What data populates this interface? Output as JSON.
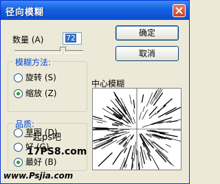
{
  "window": {
    "title": "径向模糊"
  },
  "amount": {
    "label": "数量 (A)",
    "value": "72"
  },
  "buttons": {
    "ok": "确定",
    "cancel": "取消"
  },
  "method": {
    "title": "模糊方法:",
    "options": [
      {
        "label": "旋转 (S)",
        "selected": false
      },
      {
        "label": "缩放 (Z)",
        "selected": true
      }
    ]
  },
  "quality": {
    "title": "品质:",
    "options": [
      {
        "label": "草图 (D)",
        "selected": false
      },
      {
        "label": "好 (G)",
        "selected": false
      },
      {
        "label": "最好 (B)",
        "selected": true
      }
    ]
  },
  "preview": {
    "label": "中心模糊"
  },
  "watermarks": {
    "line1": "一起ps吧",
    "line2": "17PS8.com",
    "line3": "www.Psjia.com"
  }
}
